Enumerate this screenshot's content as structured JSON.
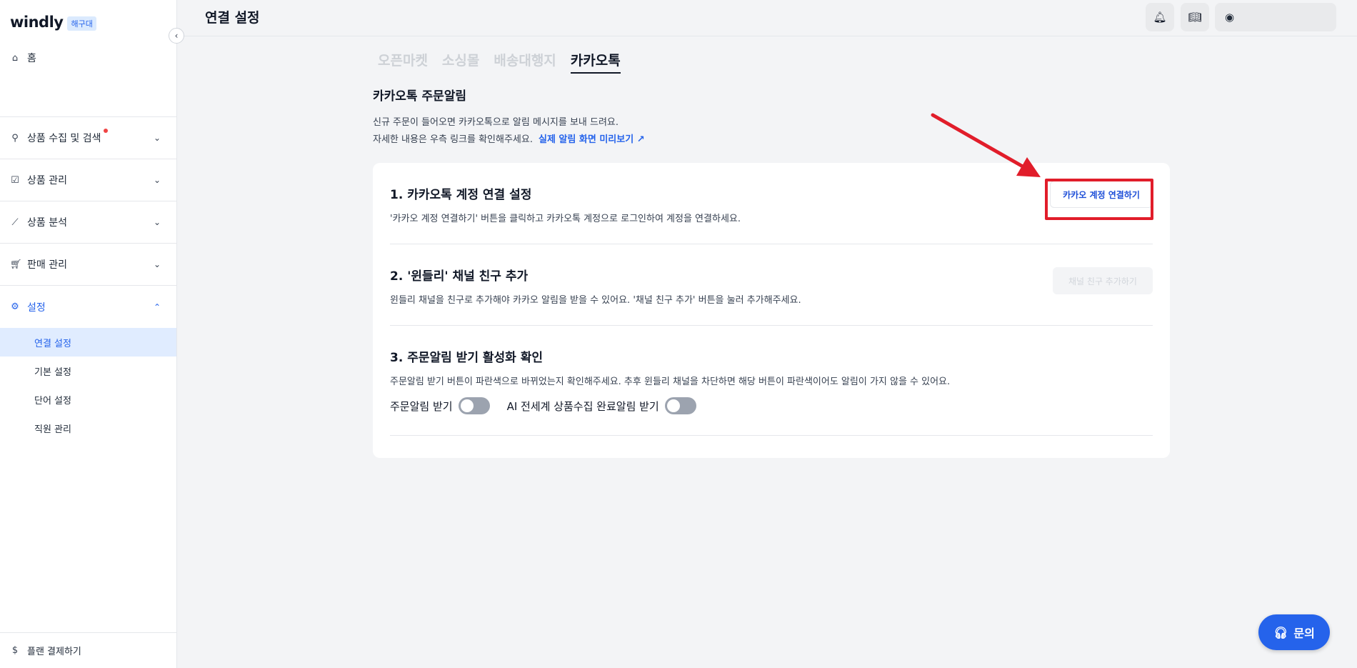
{
  "sidebar": {
    "logo": "windly",
    "badge": "해구대",
    "home": "홈",
    "sections": [
      {
        "label": "상품 수집 및 검색",
        "has_dot": true
      },
      {
        "label": "상품 관리"
      },
      {
        "label": "상품 분석"
      },
      {
        "label": "판매 관리"
      },
      {
        "label": "설정"
      }
    ],
    "settings_items": [
      "연결 설정",
      "기본 설정",
      "단어 설정",
      "직원 관리"
    ],
    "bottom": "플랜 결제하기"
  },
  "header": {
    "title": "연결 설정"
  },
  "tabs": [
    "오픈마켓",
    "소싱몰",
    "배송대행지",
    "카카오톡"
  ],
  "main": {
    "title": "카카오톡 주문알림",
    "desc1": "신규 주문이 들어오면 카카오톡으로 알림 메시지를 보내 드려요.",
    "desc2": "자세한 내용은 우측 링크를 확인해주세요.",
    "preview_link": "실제 알림 화면 미리보기",
    "steps": [
      {
        "title": "1. 카카오톡 계정 연결 설정",
        "desc": "'카카오 계정 연결하기' 버튼을 클릭하고 카카오톡 계정으로 로그인하여 계정을 연결하세요.",
        "button": "카카오 계정 연결하기"
      },
      {
        "title": "2. '윈들리' 채널 친구 추가",
        "desc": "윈들리 채널을 친구로 추가해야 카카오 알림을 받을 수 있어요. '채널 친구 추가' 버튼을 눌러 추가해주세요.",
        "button": "채널 친구 추가하기"
      },
      {
        "title": "3. 주문알림 받기 활성화 확인",
        "desc": "주문알림 받기 버튼이 파란색으로 바뀌었는지 확인해주세요. 추후 윈들리 채널을 차단하면 해당 버튼이 파란색이어도 알림이 가지 않을 수 있어요.",
        "toggle1": "주문알림 받기",
        "toggle2": "AI 전세계 상품수집 완료알림 받기"
      }
    ]
  },
  "fab": "문의",
  "colors": {
    "accent": "#2563eb",
    "annotation": "#e11d2a"
  }
}
